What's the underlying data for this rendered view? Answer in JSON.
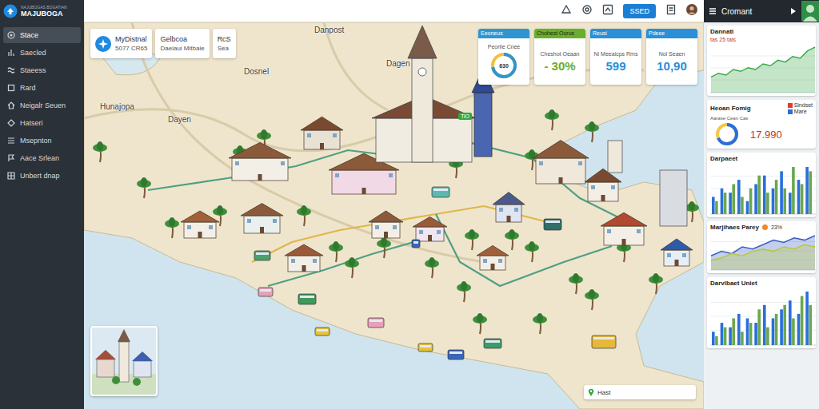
{
  "logo": {
    "small": "NAJUBOGAS BOGATIAN",
    "main": "MAJUBOGA"
  },
  "sidebar": {
    "items": [
      {
        "label": "Stace",
        "selected": true
      },
      {
        "label": "Saecled",
        "selected": false
      },
      {
        "label": "Staeess",
        "selected": false
      },
      {
        "label": "Rard",
        "selected": false
      },
      {
        "label": "Neigalr Seuen",
        "selected": false
      },
      {
        "label": "Hatseri",
        "selected": false
      },
      {
        "label": "Msepnton",
        "selected": false
      },
      {
        "label": "Aace Srlean",
        "selected": false
      },
      {
        "label": "Unbert dnap",
        "selected": false
      }
    ]
  },
  "header": {
    "button": "SSED",
    "user": "Cromant"
  },
  "map": {
    "info_cards": [
      {
        "title": "MyDistnal",
        "value": "5077 CR65"
      },
      {
        "title": "Gelbcoa",
        "value": "Daeiaui Mitbaie"
      },
      {
        "title": "RcS",
        "value": "Sea"
      }
    ],
    "labels": [
      "Danpost",
      "Dosnel",
      "Dagen",
      "Hunajopa",
      "Dayen"
    ],
    "marker": "TiO",
    "stats": [
      {
        "title": "Eeoneus",
        "subtitle": "Peorlie Cnee",
        "value": "630",
        "kind": "donut",
        "level": 0.72,
        "color": "#2f95d0"
      },
      {
        "title": "Chohest Ourus",
        "subtitle": "Cheshot Oeaan",
        "value": "- 30%",
        "kind": "value",
        "color": "#6aae2e"
      },
      {
        "title": "Reusi",
        "subtitle": "Ni Meeaicps Rms",
        "value": "599",
        "kind": "value",
        "color": "#2a8fd6"
      },
      {
        "title": "Pdeee",
        "subtitle": "Nol Seaen",
        "value": "10,90",
        "kind": "value",
        "color": "#2a8fd6"
      }
    ],
    "zoom": {
      "label": "Hast"
    }
  },
  "panels": [
    {
      "kind": "area",
      "title": "Dannati",
      "subtitle": "tas 25 tals",
      "series": [
        {
          "color": "#3aa84a",
          "values": [
            8,
            10,
            9,
            12,
            11,
            13,
            12,
            15,
            14,
            17,
            16,
            19,
            18,
            22,
            24
          ]
        }
      ]
    },
    {
      "kind": "donut",
      "title": "Heoan Fomig",
      "legend": [
        {
          "label": "Sindset",
          "color": "#e03c31"
        },
        {
          "label": "Mare",
          "color": "#2a6fdb"
        }
      ],
      "caption": "Aarase Cean Cas",
      "value": "17.990",
      "level": 0.68
    },
    {
      "kind": "bars",
      "title": "Darpaeet",
      "series": [
        {
          "color": "#2a6fdb",
          "values": [
            4,
            6,
            5,
            8,
            3,
            7,
            9,
            6,
            10,
            5,
            8,
            11
          ]
        },
        {
          "color": "#6aa84f",
          "values": [
            3,
            5,
            7,
            4,
            6,
            9,
            5,
            8,
            6,
            11,
            7,
            10
          ]
        }
      ]
    },
    {
      "kind": "area",
      "title": "Marjihaes Parey",
      "subtitle": "23%",
      "series": [
        {
          "color": "#3b5fc4",
          "values": [
            6,
            8,
            7,
            10,
            9,
            11,
            13,
            12,
            14,
            13,
            15
          ]
        },
        {
          "color": "#b8c93a",
          "values": [
            4,
            5,
            7,
            6,
            8,
            9,
            8,
            10,
            9,
            11,
            10
          ]
        }
      ]
    },
    {
      "kind": "bars",
      "title": "Darvlbaet Uniet",
      "series": [
        {
          "color": "#2a6fdb",
          "values": [
            3,
            5,
            4,
            7,
            6,
            5,
            9,
            6,
            8,
            10,
            7,
            12
          ]
        },
        {
          "color": "#6aa84f",
          "values": [
            2,
            4,
            6,
            3,
            5,
            8,
            4,
            7,
            9,
            6,
            11,
            9
          ]
        }
      ]
    }
  ]
}
